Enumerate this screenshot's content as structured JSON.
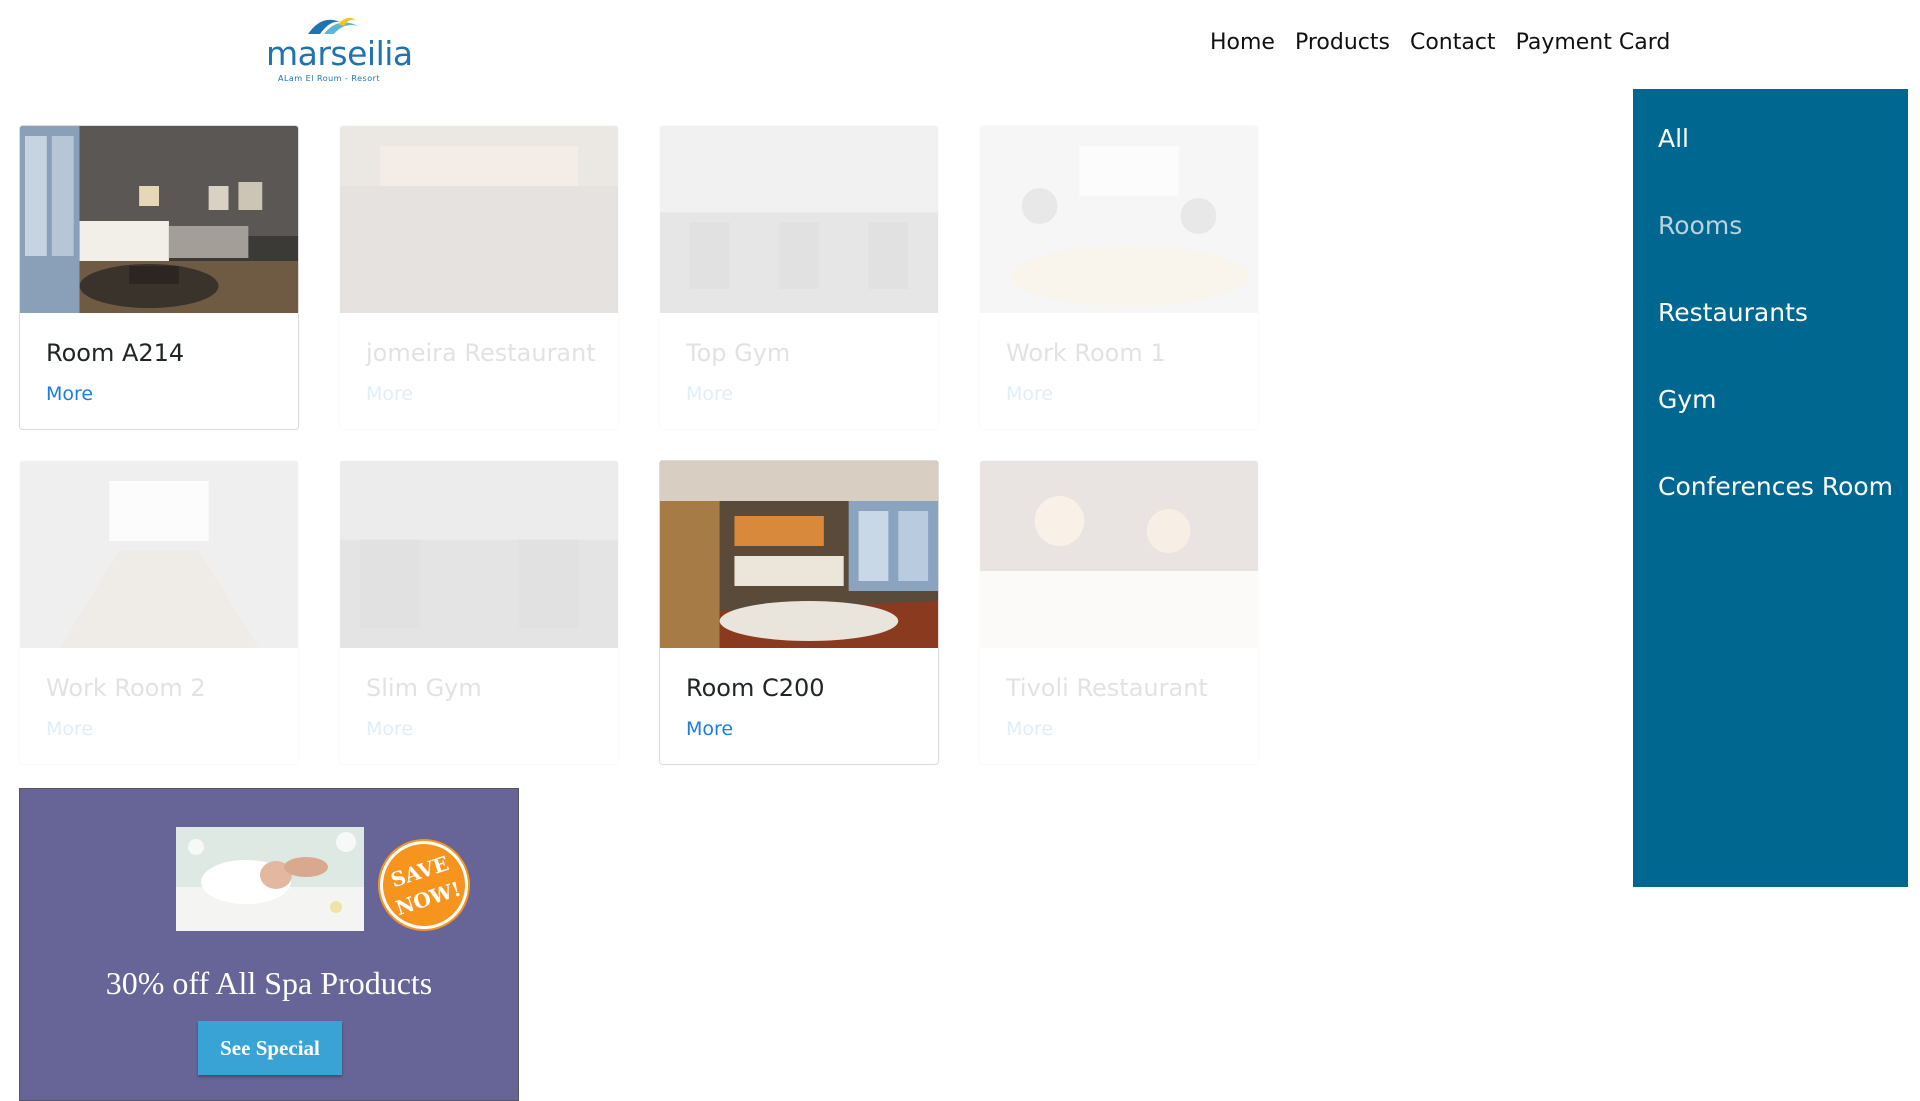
{
  "header": {
    "logo": {
      "name": "marseilia",
      "tagline": "ALam El Roum - Resort"
    },
    "nav": [
      "Home",
      "Products",
      "Contact",
      "Payment Card"
    ]
  },
  "cards": [
    {
      "title": "Room A214",
      "more": "More",
      "faded": false
    },
    {
      "title": "jomeira Restaurant",
      "more": "More",
      "faded": true
    },
    {
      "title": "Top Gym",
      "more": "More",
      "faded": true
    },
    {
      "title": "Work Room 1",
      "more": "More",
      "faded": true
    },
    {
      "title": "Work Room 2",
      "more": "More",
      "faded": true
    },
    {
      "title": "Slim Gym",
      "more": "More",
      "faded": true
    },
    {
      "title": "Room C200",
      "more": "More",
      "faded": false
    },
    {
      "title": "Tivoli Restaurant",
      "more": "More",
      "faded": true
    }
  ],
  "sidebar": {
    "items": [
      {
        "label": "All"
      },
      {
        "label": "Rooms"
      },
      {
        "label": "Restaurants"
      },
      {
        "label": "Gym"
      },
      {
        "label": "Conferences Room"
      }
    ]
  },
  "promo": {
    "badge": "SAVE\nNOW!",
    "headline": "30% off All Spa Products",
    "button": "See Special"
  },
  "colors": {
    "sidebar": "#006890",
    "promo_bg": "#676598",
    "link": "#1a7ee0",
    "badge": "#f7941d",
    "button": "#3aa3d6"
  }
}
